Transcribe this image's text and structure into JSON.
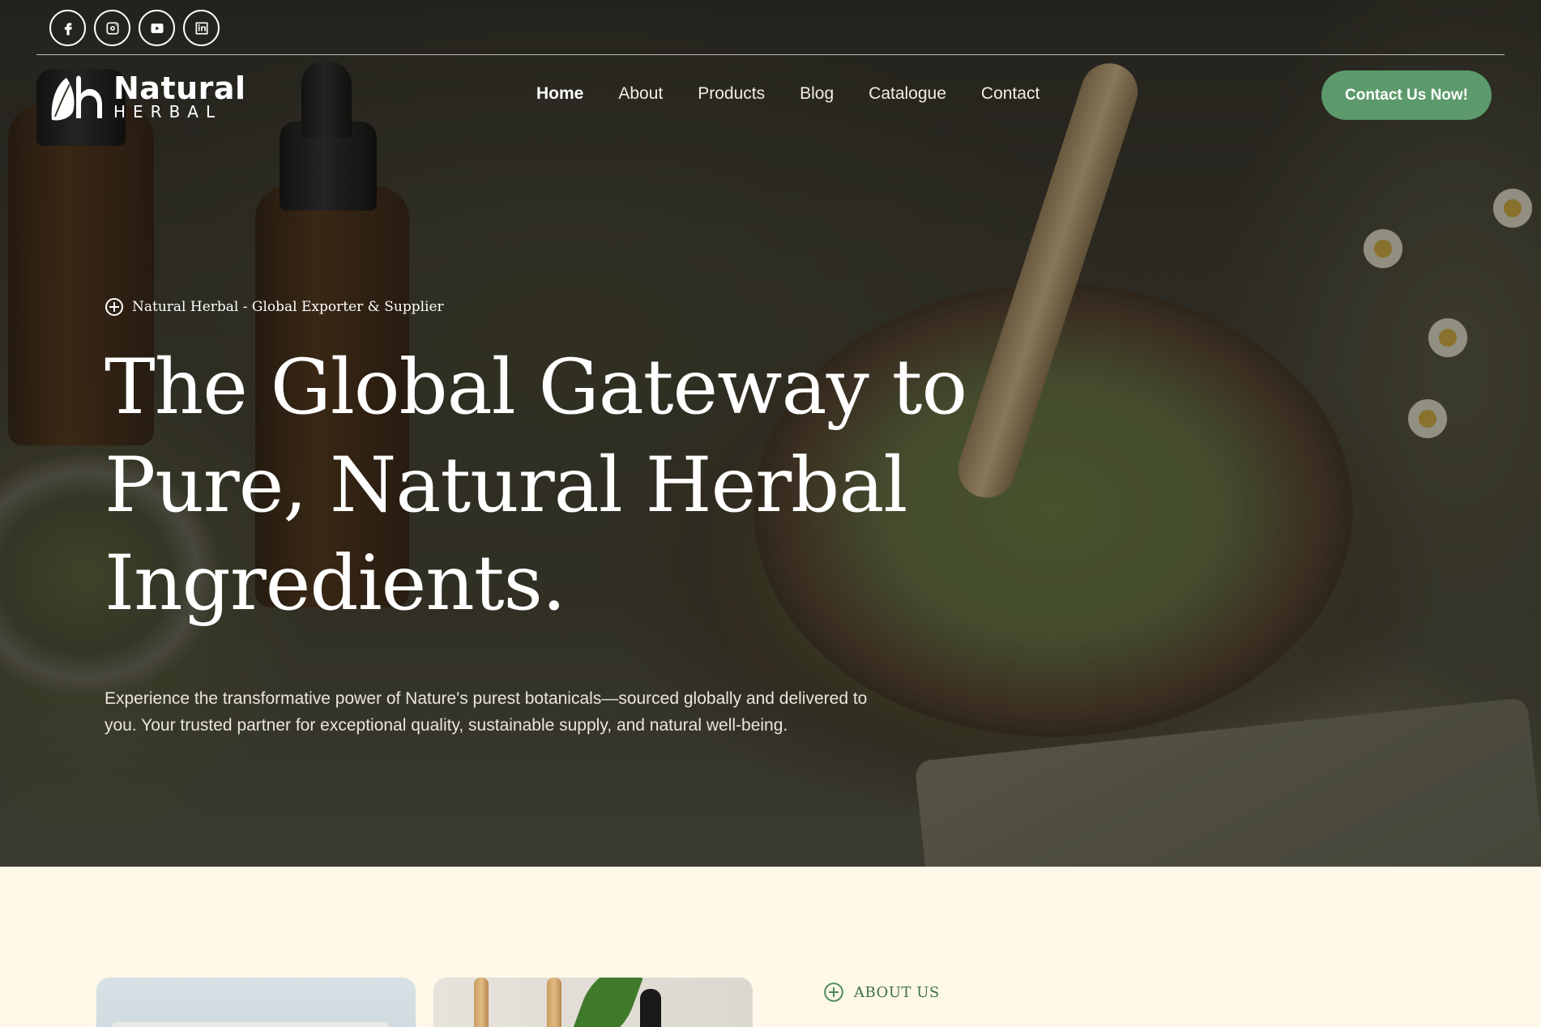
{
  "social": {
    "items": [
      {
        "name": "facebook"
      },
      {
        "name": "instagram"
      },
      {
        "name": "youtube"
      },
      {
        "name": "linkedin"
      }
    ]
  },
  "logo": {
    "word": "Natural",
    "sub": "HERBAL"
  },
  "nav": {
    "items": [
      {
        "label": "Home",
        "active": true
      },
      {
        "label": "About"
      },
      {
        "label": "Products"
      },
      {
        "label": "Blog"
      },
      {
        "label": "Catalogue"
      },
      {
        "label": "Contact"
      }
    ]
  },
  "cta": {
    "label": "Contact Us Now!",
    "color": "#5c9a6b"
  },
  "hero": {
    "tagline": "Natural Herbal - Global Exporter & Supplier",
    "headline": {
      "line1": "The Global Gateway to",
      "line2": "Pure, Natural Herbal",
      "line3": "Ingredients."
    },
    "lead": {
      "line1": "Experience the transformative power of Nature's purest botanicals—sourced globally and delivered to",
      "line2": "you. Your trusted partner for exceptional quality, sustainable supply, and natural well-being."
    }
  },
  "about": {
    "label": "ABOUT US"
  },
  "colors": {
    "accent": "#5c9a6b",
    "background": "#fdf8e8"
  }
}
